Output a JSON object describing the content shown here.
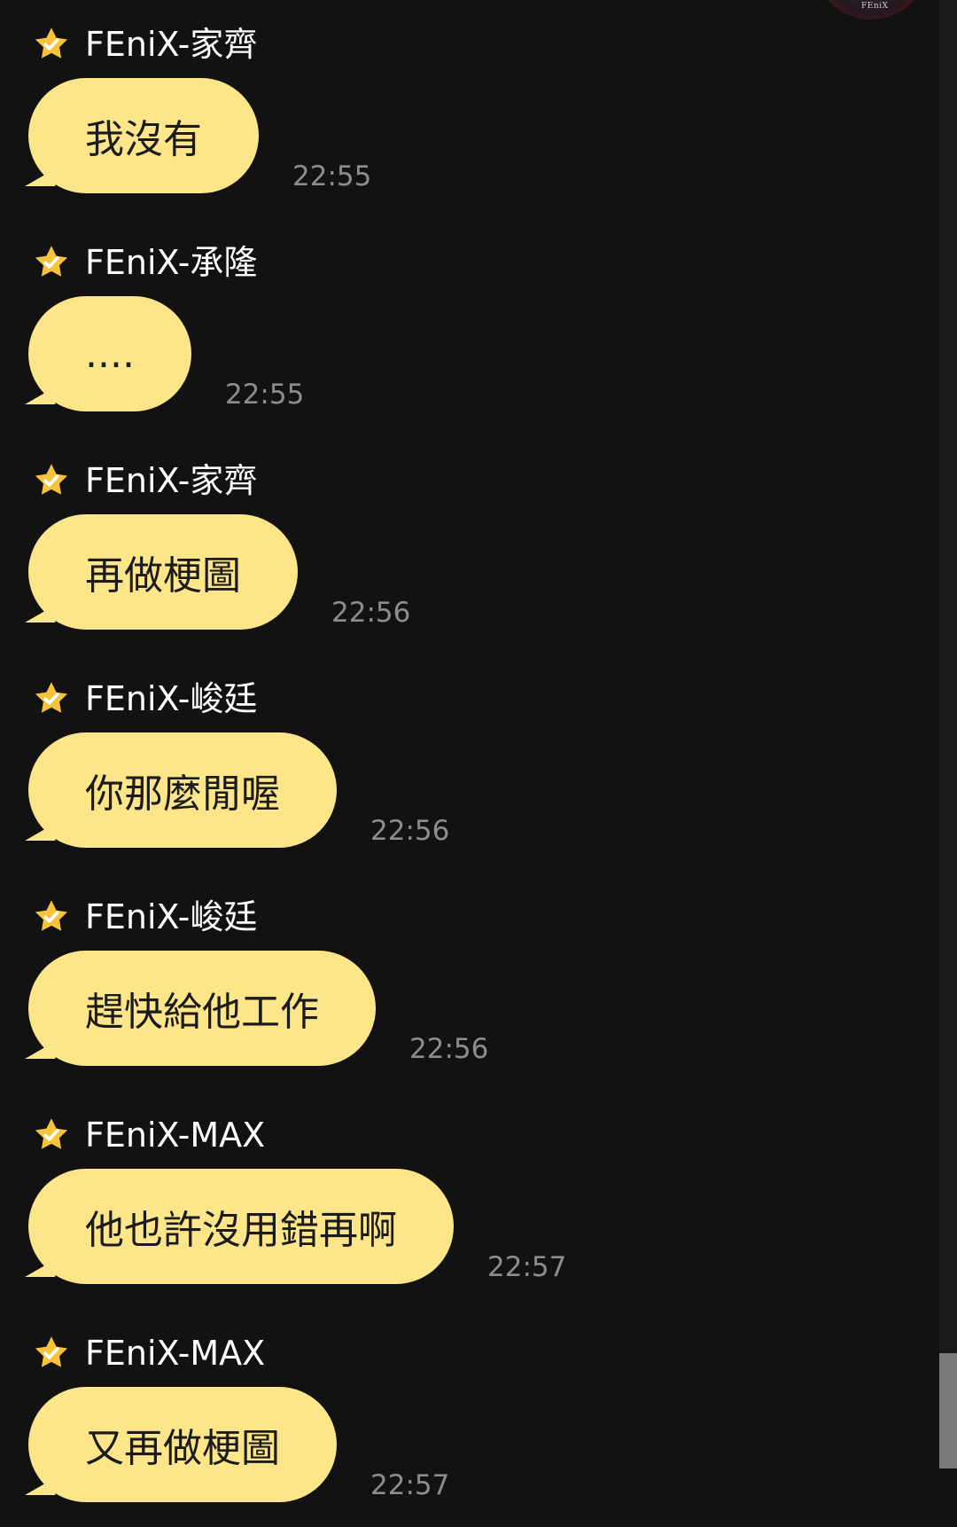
{
  "app": {
    "avatar_text": "FEniX"
  },
  "icons": {
    "sender_badge": "gold-star-check-icon",
    "avatar": "group-avatar-icon"
  },
  "colors": {
    "background": "#121212",
    "bubble": "#fde68a",
    "star_gold": "#f6c33b",
    "star_check": "#ffffff",
    "sender_name": "#ffffff",
    "timestamp": "#8d8d8d"
  },
  "messages": [
    {
      "sender": "FEniX-家齊",
      "text": "我沒有",
      "time": "22:55"
    },
    {
      "sender": "FEniX-承隆",
      "text": "....",
      "time": "22:55"
    },
    {
      "sender": "FEniX-家齊",
      "text": "再做梗圖",
      "time": "22:56"
    },
    {
      "sender": "FEniX-峻廷",
      "text": "你那麼閒喔",
      "time": "22:56"
    },
    {
      "sender": "FEniX-峻廷",
      "text": "趕快給他工作",
      "time": "22:56"
    },
    {
      "sender": "FEniX-MAX",
      "text": "他也許沒用錯再啊",
      "time": "22:57"
    },
    {
      "sender": "FEniX-MAX",
      "text": "又再做梗圖",
      "time": "22:57"
    }
  ]
}
